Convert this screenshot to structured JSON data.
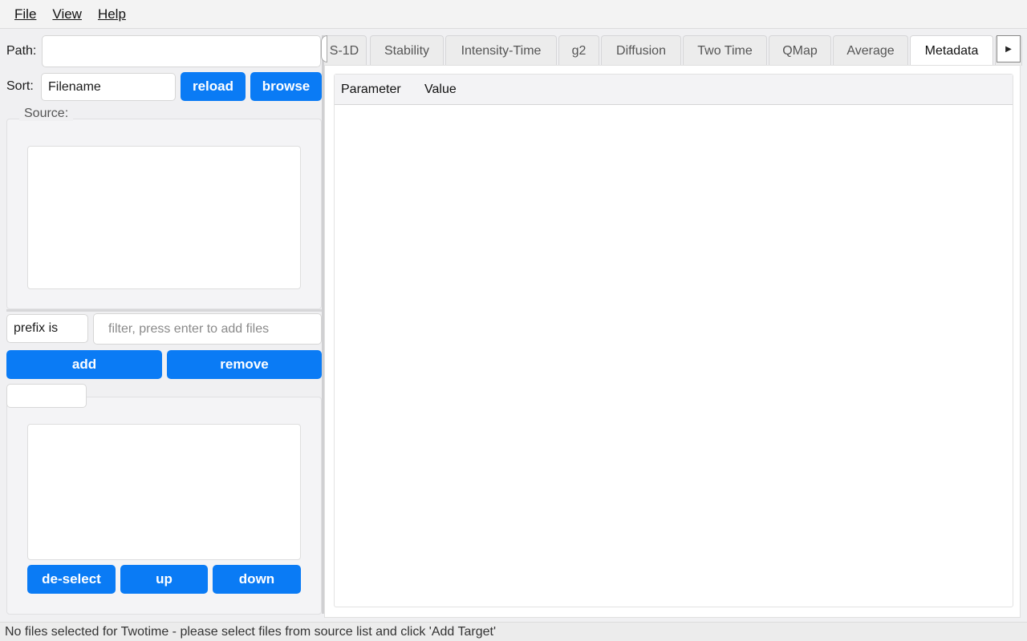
{
  "menu": {
    "file": "File",
    "view": "View",
    "help": "Help"
  },
  "left": {
    "path_label": "Path:",
    "path_value": "",
    "sort_label": "Sort:",
    "sort_value": "Filename",
    "reload_label": "reload",
    "browse_label": "browse",
    "source_title": "Source:",
    "filter_mode": "prefix is",
    "filter_placeholder": "filter, press enter to add files",
    "add_label": "add",
    "remove_label": "remove",
    "target_title": "",
    "deselect_label": "de-select",
    "up_label": "up",
    "down_label": "down"
  },
  "tabs": [
    {
      "label": "S-1D"
    },
    {
      "label": "Stability"
    },
    {
      "label": "Intensity-Time"
    },
    {
      "label": "g2"
    },
    {
      "label": "Diffusion"
    },
    {
      "label": "Two Time"
    },
    {
      "label": "QMap"
    },
    {
      "label": "Average"
    },
    {
      "label": "Metadata"
    }
  ],
  "active_tab": "Metadata",
  "table": {
    "col_parameter": "Parameter",
    "col_value": "Value"
  },
  "status": "No files selected for Twotime - please select files from source list and click 'Add Target'",
  "colors": {
    "accent": "#0a7bf5"
  }
}
